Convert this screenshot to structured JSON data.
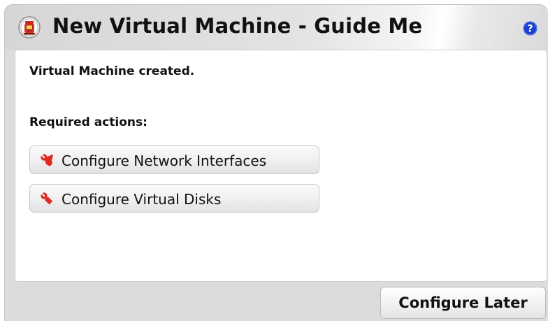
{
  "dialog": {
    "title": "New Virtual Machine - Guide Me",
    "app_icon": "vm-app-icon",
    "help_icon": "help-icon",
    "accent_color": "#1b3fcf"
  },
  "content": {
    "status": "Virtual Machine created.",
    "required_label": "Required actions:",
    "actions": [
      {
        "label": "Configure Network Interfaces",
        "icon": "wrench-icon"
      },
      {
        "label": "Configure Virtual Disks",
        "icon": "wrench-icon"
      }
    ]
  },
  "footer": {
    "later_label": "Configure Later"
  }
}
